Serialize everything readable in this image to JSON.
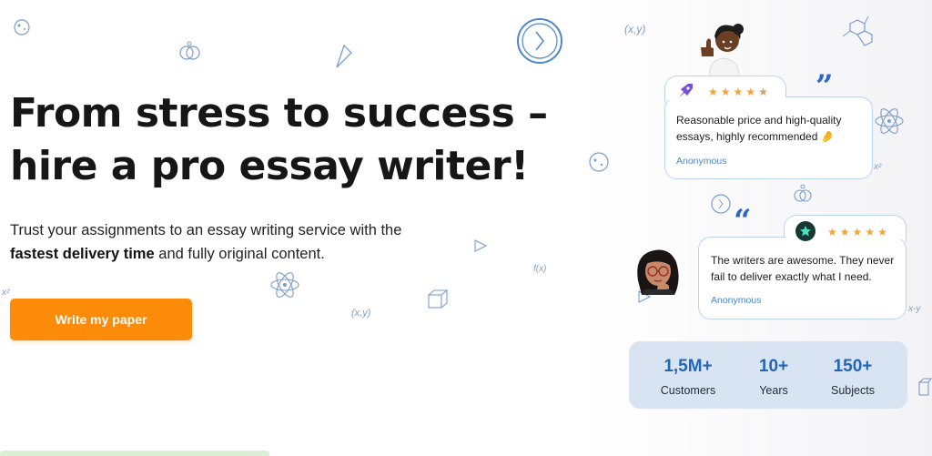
{
  "hero": {
    "title_line1": "From stress to success –",
    "title_line2": "hire a pro essay writer!",
    "subtitle_part1": "Trust your assignments to an essay writing service with the",
    "subtitle_bold": "fastest delivery time",
    "subtitle_part2": "and fully original content.",
    "cta_label": "Write my paper"
  },
  "reviews": [
    {
      "text_line1": "Reasonable price and high-quality",
      "text_line2": "essays, highly recommended 🤌",
      "author": "Anonymous",
      "stars": 4.5
    },
    {
      "text_line1": "The writers are awesome. They never",
      "text_line2": "fail to deliver exactly what I need.",
      "author": "Anonymous",
      "stars": 5
    }
  ],
  "stats": [
    {
      "value": "1,5M+",
      "label": "Customers"
    },
    {
      "value": "10+",
      "label": "Years"
    },
    {
      "value": "150+",
      "label": "Subjects"
    }
  ],
  "doodles": {
    "xy_1": "(x,y)",
    "xy_2": "(x,y)",
    "xy_3": "x-y",
    "fx": "f(x)",
    "x2_1": "x²",
    "x2_2": "x²"
  },
  "colors": {
    "accent_orange": "#fd8b0a",
    "stat_blue": "#2266b5",
    "card_border": "#bcd3f0",
    "star": "#f2a33a",
    "stats_bg": "#d8e4f2"
  }
}
